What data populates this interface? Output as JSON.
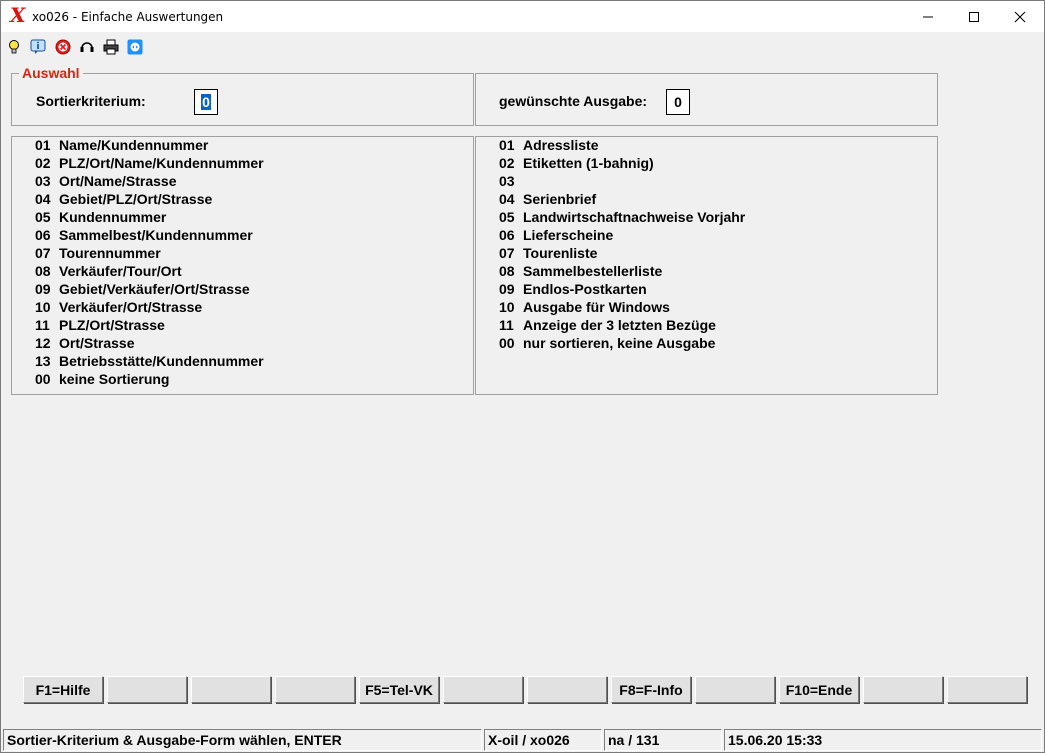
{
  "window": {
    "title": "xo026 - Einfache Auswertungen",
    "logo": "X"
  },
  "toolbar": {
    "icons": [
      "lightbulb-icon",
      "info-icon",
      "cancel-icon",
      "headset-icon",
      "printer-icon",
      "remote-support-icon"
    ]
  },
  "selection": {
    "legend": "Auswahl",
    "sort_label": "Sortierkriterium:",
    "sort_value": "0",
    "output_label": "gewünschte Ausgabe:",
    "output_value": "0"
  },
  "sort_options": [
    {
      "num": "01",
      "label": "Name/Kundennummer"
    },
    {
      "num": "02",
      "label": "PLZ/Ort/Name/Kundennummer"
    },
    {
      "num": "03",
      "label": "Ort/Name/Strasse"
    },
    {
      "num": "04",
      "label": "Gebiet/PLZ/Ort/Strasse"
    },
    {
      "num": "05",
      "label": "Kundennummer"
    },
    {
      "num": "06",
      "label": "Sammelbest/Kundennummer"
    },
    {
      "num": "07",
      "label": "Tourennummer"
    },
    {
      "num": "08",
      "label": "Verkäufer/Tour/Ort"
    },
    {
      "num": "09",
      "label": "Gebiet/Verkäufer/Ort/Strasse"
    },
    {
      "num": "10",
      "label": "Verkäufer/Ort/Strasse"
    },
    {
      "num": "11",
      "label": "PLZ/Ort/Strasse"
    },
    {
      "num": "12",
      "label": "Ort/Strasse"
    },
    {
      "num": "13",
      "label": "Betriebsstätte/Kundennummer"
    },
    {
      "num": "00",
      "label": "keine Sortierung"
    }
  ],
  "output_options": [
    {
      "num": "01",
      "label": "Adressliste"
    },
    {
      "num": "02",
      "label": "Etiketten (1-bahnig)"
    },
    {
      "num": "03",
      "label": ""
    },
    {
      "num": "04",
      "label": "Serienbrief"
    },
    {
      "num": "05",
      "label": "Landwirtschaftnachweise Vorjahr"
    },
    {
      "num": "06",
      "label": "Lieferscheine"
    },
    {
      "num": "07",
      "label": "Tourenliste"
    },
    {
      "num": "08",
      "label": "Sammelbestellerliste"
    },
    {
      "num": "09",
      "label": "Endlos-Postkarten"
    },
    {
      "num": "10",
      "label": "Ausgabe für Windows"
    },
    {
      "num": "11",
      "label": "Anzeige der 3 letzten Bezüge"
    },
    {
      "num": "00",
      "label": "nur sortieren, keine Ausgabe"
    }
  ],
  "function_keys": [
    "F1=Hilfe",
    "",
    "",
    "",
    "F5=Tel-VK",
    "",
    "",
    "F8=F-Info",
    "",
    "F10=Ende",
    "",
    ""
  ],
  "status": {
    "message": "Sortier-Kriterium & Ausgabe-Form wählen, ENTER",
    "program": "X-oil / xo026",
    "user": "na / 131",
    "datetime": "15.06.20 15:33"
  }
}
